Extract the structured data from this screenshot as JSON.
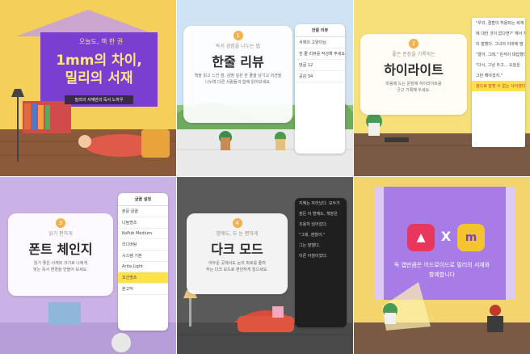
{
  "tiles": [
    {
      "id": "tile-1",
      "subtitle": "오늘도, 책 한 권",
      "title_line1": "1mm의 차이,",
      "title_line2": "밀리의 서재",
      "banner": "밀리의 서재만의 독서 노하우",
      "colors": {
        "bg": "#f4cf5a",
        "board": "#7a3fd1"
      }
    },
    {
      "id": "tile-2",
      "number": "1",
      "subtitle": "독서 경험을 나누는 법",
      "title": "한줄 리뷰",
      "desc_line1": "책을 읽고 느낀 점, 감명 깊은 한 줄을 남기고 의견을",
      "desc_line2": "나누며 다른 사람들과 함께 읽어보세요.",
      "phone_header": "한줄 리뷰",
      "phone_rows": [
        "서재의 고양이님",
        "한 줄 리뷰를 작성해 주세요",
        "댓글 12",
        "공감 34"
      ]
    },
    {
      "id": "tile-3",
      "number": "2",
      "subtitle": "좋은 문장을 기록하는",
      "title": "하이라이트",
      "desc_line1": "마음에 드는 문장에 하이라이트를",
      "desc_line2": "긋고 기록해 두세요.",
      "page_lines": [
        "\"우리, 결혼이 허용되는 세계",
        "에 대한 것이 없다면?\" 해서 지민",
        "이 말했다. 그녀의 이마에 땀",
        "\"알아, 그래.\" 민석이 대답했다.",
        "\"다시, 그냥 두고... 오늘은",
        "그만 해야겠지.\""
      ],
      "highlight": "참으로 말할 수 없는 사이였다."
    },
    {
      "id": "tile-4",
      "number": "3",
      "subtitle": "읽기 편하게",
      "title": "폰트 체인지",
      "desc_line1": "읽기 좋은 서체와 크기로 나에게",
      "desc_line2": "맞는 독서 환경을 만들어 보세요.",
      "phone_header": "글꼴 설정",
      "phone_rows": [
        "본문 글꼴",
        "나눔명조",
        "KoPub Medium",
        "리디바탕",
        "시스템 기본",
        "Arita Light",
        "조선명조",
        "본고딕"
      ]
    },
    {
      "id": "tile-5",
      "number": "4",
      "subtitle": "밤에도, 두 눈 편하게",
      "title": "다크 모드",
      "desc_line1": "어두운 곳에서도 눈의 피로를 줄여",
      "desc_line2": "주는 다크 모드로 편안하게 읽으세요.",
      "dark_lines": [
        "지혜는 자라났다. 모두가",
        "잠든 이 밤에도, 책장은",
        "조용히 넘어갔다.",
        "\"그래, 괜찮아.\"",
        "그는 말했다.",
        "이른 아침이었다."
      ]
    },
    {
      "id": "tile-6",
      "x_mark": "X",
      "message_line1": "독 앱만큼은 어드로이드로 밀리의 서재와",
      "message_line2": "함께합니다",
      "colors": {
        "bg": "#f3d46d",
        "window": "#a87ce6",
        "logo_left": "#e8365d",
        "logo_right": "#7a3fd1"
      }
    }
  ]
}
